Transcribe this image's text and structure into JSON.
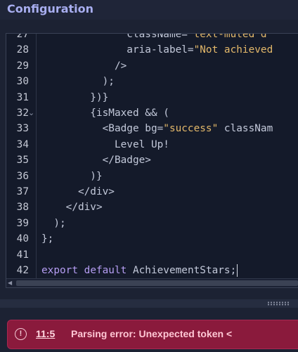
{
  "header": {
    "title": "Configuration"
  },
  "editor": {
    "lines": [
      {
        "num": "27",
        "fold": "",
        "tokens": [
          {
            "t": "              ",
            "c": "default"
          },
          {
            "t": "className=",
            "c": "default"
          },
          {
            "t": "\"text-muted d",
            "c": "str"
          }
        ]
      },
      {
        "num": "28",
        "fold": "",
        "tokens": [
          {
            "t": "              aria-label=",
            "c": "default"
          },
          {
            "t": "\"Not achieved",
            "c": "str"
          }
        ]
      },
      {
        "num": "29",
        "fold": "",
        "tokens": [
          {
            "t": "            />",
            "c": "default"
          }
        ]
      },
      {
        "num": "30",
        "fold": "",
        "tokens": [
          {
            "t": "          );",
            "c": "default"
          }
        ]
      },
      {
        "num": "31",
        "fold": "",
        "tokens": [
          {
            "t": "        })}",
            "c": "default"
          }
        ]
      },
      {
        "num": "32",
        "fold": "⌄",
        "tokens": [
          {
            "t": "        {isMaxed && (",
            "c": "default"
          }
        ]
      },
      {
        "num": "33",
        "fold": "",
        "tokens": [
          {
            "t": "          <Badge bg=",
            "c": "default"
          },
          {
            "t": "\"success\"",
            "c": "str"
          },
          {
            "t": " classNam",
            "c": "default"
          }
        ]
      },
      {
        "num": "34",
        "fold": "",
        "tokens": [
          {
            "t": "            Level Up!",
            "c": "default"
          }
        ]
      },
      {
        "num": "35",
        "fold": "",
        "tokens": [
          {
            "t": "          </Badge>",
            "c": "default"
          }
        ]
      },
      {
        "num": "36",
        "fold": "",
        "tokens": [
          {
            "t": "        )}",
            "c": "default"
          }
        ]
      },
      {
        "num": "37",
        "fold": "",
        "tokens": [
          {
            "t": "      </div>",
            "c": "default"
          }
        ]
      },
      {
        "num": "38",
        "fold": "",
        "tokens": [
          {
            "t": "    </div>",
            "c": "default"
          }
        ]
      },
      {
        "num": "39",
        "fold": "",
        "tokens": [
          {
            "t": "  );",
            "c": "default"
          }
        ]
      },
      {
        "num": "40",
        "fold": "",
        "tokens": [
          {
            "t": "};",
            "c": "default"
          }
        ]
      },
      {
        "num": "41",
        "fold": "",
        "tokens": []
      },
      {
        "num": "42",
        "fold": "",
        "tokens": [
          {
            "t": "export",
            "c": "kw"
          },
          {
            "t": " ",
            "c": "default"
          },
          {
            "t": "default",
            "c": "kw"
          },
          {
            "t": " AchievementStars;",
            "c": "default"
          }
        ],
        "cursor": true
      }
    ]
  },
  "error": {
    "icon": "error-circle-icon",
    "location": "11:5",
    "message": "Parsing error: Unexpected token <"
  }
}
